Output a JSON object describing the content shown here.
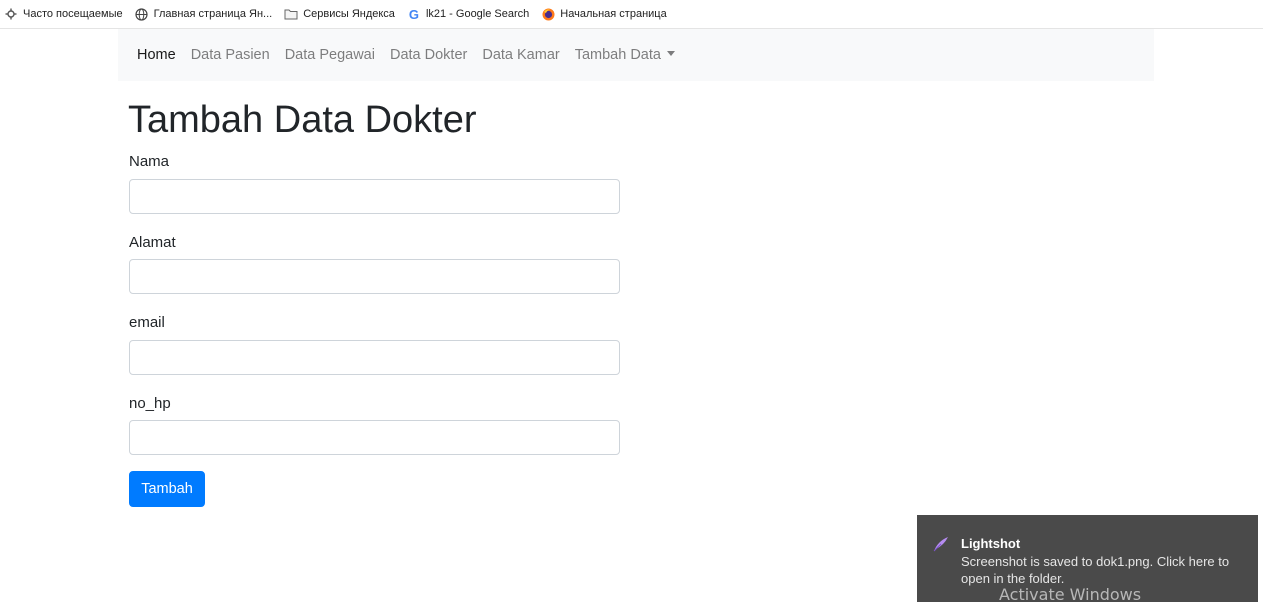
{
  "bookmarks": [
    {
      "label": "Часто посещаемые",
      "icon": "gear-icon"
    },
    {
      "label": "Главная страница Ян...",
      "icon": "globe-icon"
    },
    {
      "label": "Сервисы Яндекса",
      "icon": "folder-icon"
    },
    {
      "label": "lk21 - Google Search",
      "icon": "google-icon"
    },
    {
      "label": "Начальная страница",
      "icon": "firefox-icon"
    }
  ],
  "navbar": {
    "links": [
      "Home",
      "Data Pasien",
      "Data Pegawai",
      "Data Dokter",
      "Data Kamar"
    ],
    "dropdown_label": "Tambah Data"
  },
  "page": {
    "title": "Tambah Data Dokter"
  },
  "form": {
    "fields": [
      {
        "label": "Nama",
        "value": ""
      },
      {
        "label": "Alamat",
        "value": ""
      },
      {
        "label": "email",
        "value": ""
      },
      {
        "label": "no_hp",
        "value": ""
      }
    ],
    "submit_label": "Tambah"
  },
  "notification": {
    "title": "Lightshot",
    "message": "Screenshot is saved to dok1.png. Click here to open in the folder.",
    "icon": "feather-icon"
  },
  "watermark": {
    "text": "Activate Windows"
  },
  "colors": {
    "primary": "#007bff",
    "navbar_bg": "#f8f9fa",
    "toast_bg": "#4a4a4a"
  }
}
